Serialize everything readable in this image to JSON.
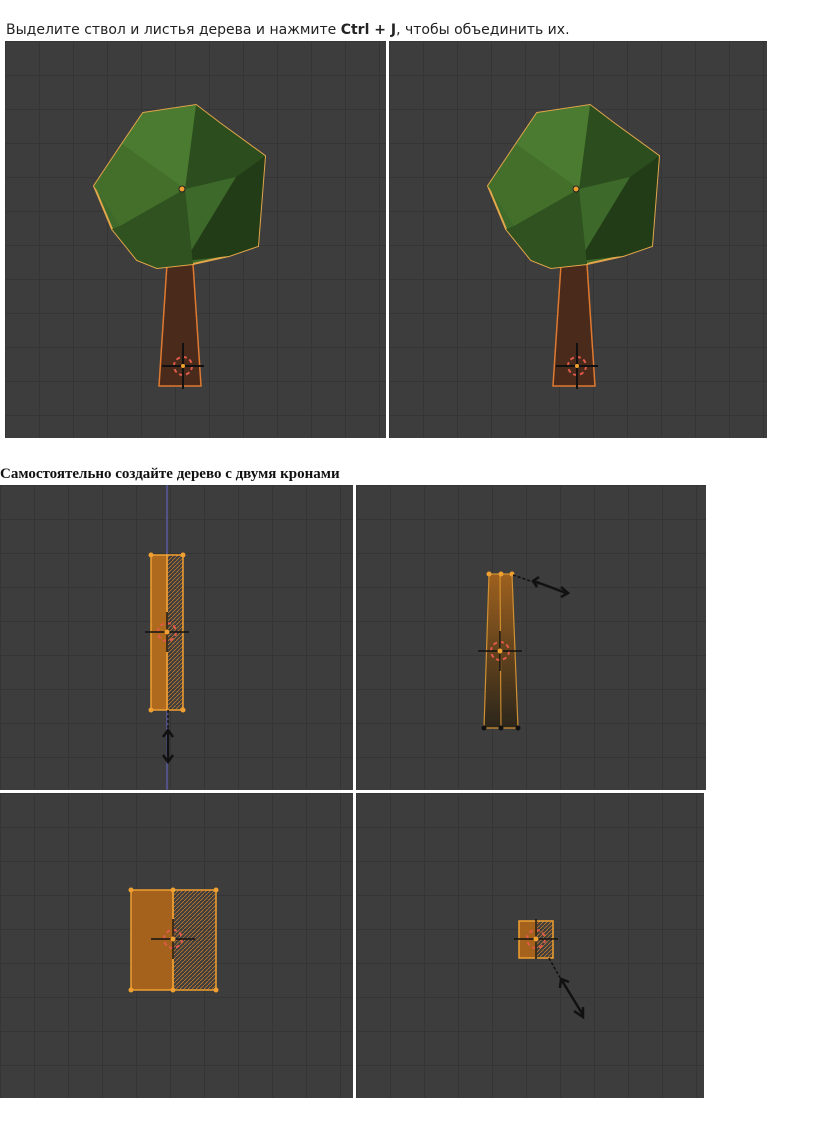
{
  "instruction": {
    "before": "Выделите ствол и листья дерева и нажмите ",
    "shortcut": "Ctrl + J",
    "after": ", чтобы объединить их."
  },
  "task_heading": "Самостоятельно создайте дерево  с  двумя кронами",
  "colors": {
    "viewport_bg": "#3d3d3d",
    "grid_line": "#353535",
    "crown_green": "#3f6a2a",
    "crown_dark": "#243d18",
    "trunk_brown": "#4a2a1a",
    "selection_orange": "#f0a030"
  },
  "viewports": [
    {
      "name": "tree-before-join",
      "content": "tree"
    },
    {
      "name": "tree-after-join",
      "content": "tree"
    },
    {
      "name": "trunk-front-view",
      "content": "trunk-front"
    },
    {
      "name": "trunk-taper-view",
      "content": "trunk-taper"
    },
    {
      "name": "trunk-side-view",
      "content": "trunk-side"
    },
    {
      "name": "trunk-top-view",
      "content": "trunk-top"
    }
  ]
}
